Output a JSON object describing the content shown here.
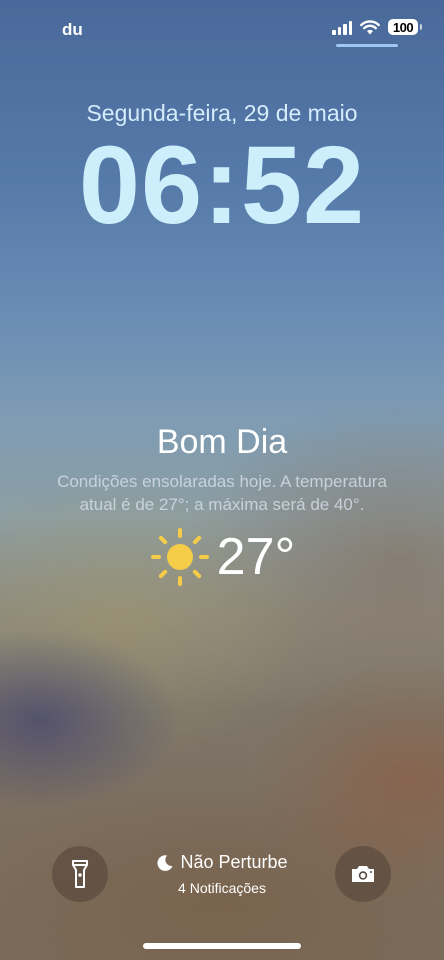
{
  "status_bar": {
    "carrier": "du",
    "battery_level": "100",
    "icons": [
      "signal-icon",
      "wifi-icon",
      "battery-icon"
    ]
  },
  "lock_screen": {
    "date": "Segunda-feira, 29 de maio",
    "time": "06:52"
  },
  "weather_widget": {
    "greeting": "Bom Dia",
    "description": "Condições ensolaradas hoje. A temperatura atual é de 27°; a máxima será de 40°.",
    "condition_icon": "sun-icon",
    "temperature": "27°",
    "sun_color": "#f5cc48"
  },
  "bottom_bar": {
    "left_button_icon": "flashlight-icon",
    "right_button_icon": "camera-icon",
    "focus_icon": "moon-icon",
    "focus_mode": "Não Perturbe",
    "notifications": "4 Notificações"
  },
  "colors": {
    "clock": "#cdeefb",
    "date": "#d4ecfb"
  }
}
